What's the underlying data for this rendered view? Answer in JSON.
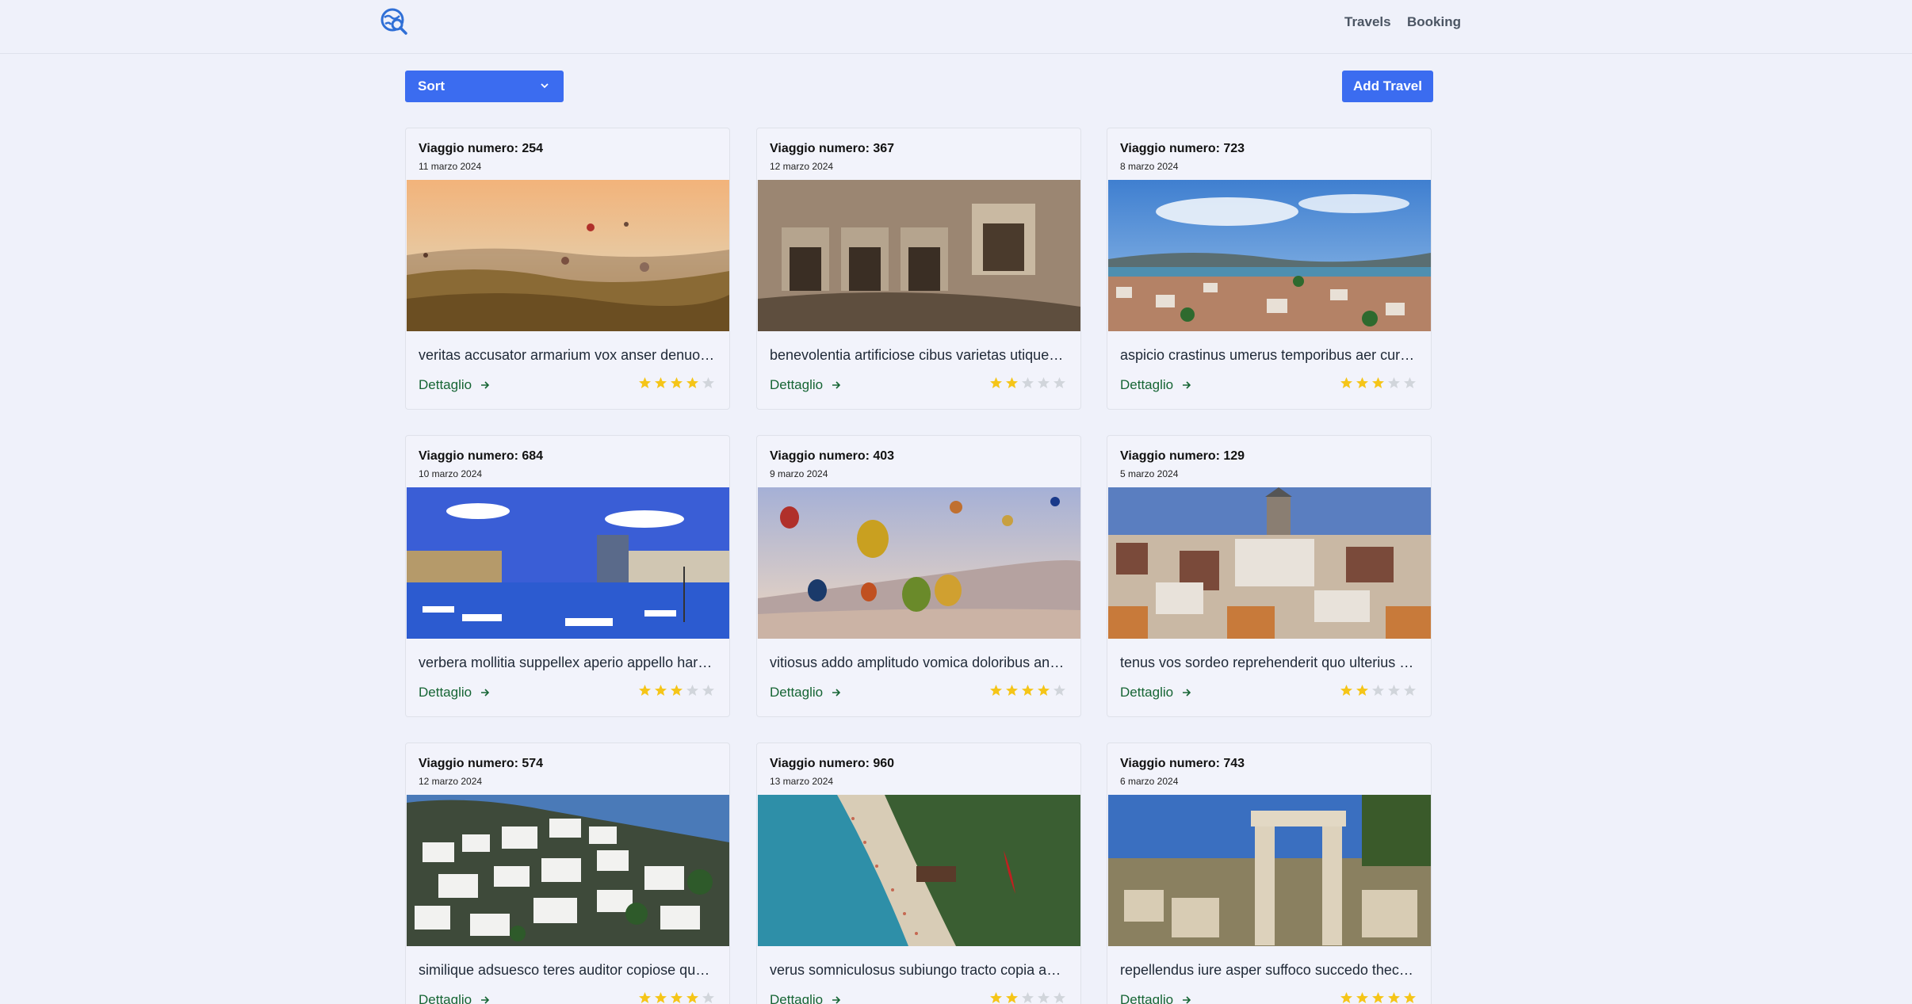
{
  "nav": {
    "logo_icon": "globe-search-icon",
    "links": [
      "Travels",
      "Booking"
    ]
  },
  "toolbar": {
    "sort_label": "Sort",
    "add_label": "Add Travel"
  },
  "colors": {
    "accent": "#3b6cf0",
    "star_on": "#f5c518",
    "star_off": "#d1d5db",
    "link": "#166534"
  },
  "cards": [
    {
      "title": "Viaggio numero: 254",
      "date": "11 marzo 2024",
      "description": "veritas accusator armarium vox anser denuo…",
      "link": "Dettaglio",
      "rating": 4,
      "image": "hot-air-balloons-sunset-valley"
    },
    {
      "title": "Viaggio numero: 367",
      "date": "12 marzo 2024",
      "description": "benevolentia artificiose cibus varietas utique…",
      "link": "Dettaglio",
      "rating": 2,
      "image": "rock-cut-tombs-cliff"
    },
    {
      "title": "Viaggio numero: 723",
      "date": "8 marzo 2024",
      "description": "aspicio crastinus umerus temporibus aer cur…",
      "link": "Dettaglio",
      "rating": 3,
      "image": "coastal-town-bay"
    },
    {
      "title": "Viaggio numero: 684",
      "date": "10 marzo 2024",
      "description": "verbera mollitia suppellex aperio appello har…",
      "link": "Dettaglio",
      "rating": 3,
      "image": "harbor-marina-castle"
    },
    {
      "title": "Viaggio numero: 403",
      "date": "9 marzo 2024",
      "description": "vitiosus addo amplitudo vomica doloribus an…",
      "link": "Dettaglio",
      "rating": 4,
      "image": "colorful-hot-air-balloons"
    },
    {
      "title": "Viaggio numero: 129",
      "date": "5 marzo 2024",
      "description": "tenus vos sordeo reprehenderit quo ulterius …",
      "link": "Dettaglio",
      "rating": 2,
      "image": "city-tower-hillside"
    },
    {
      "title": "Viaggio numero: 574",
      "date": "12 marzo 2024",
      "description": "similique adsuesco teres auditor copiose qu…",
      "link": "Dettaglio",
      "rating": 4,
      "image": "white-houses-hillside"
    },
    {
      "title": "Viaggio numero: 960",
      "date": "13 marzo 2024",
      "description": "verus somniculosus subiungo tracto copia a…",
      "link": "Dettaglio",
      "rating": 2,
      "image": "aerial-beach-lagoon"
    },
    {
      "title": "Viaggio numero: 743",
      "date": "6 marzo 2024",
      "description": "repellendus iure asper suffoco succedo thec…",
      "link": "Dettaglio",
      "rating": 5,
      "image": "ancient-stone-ruins"
    }
  ]
}
